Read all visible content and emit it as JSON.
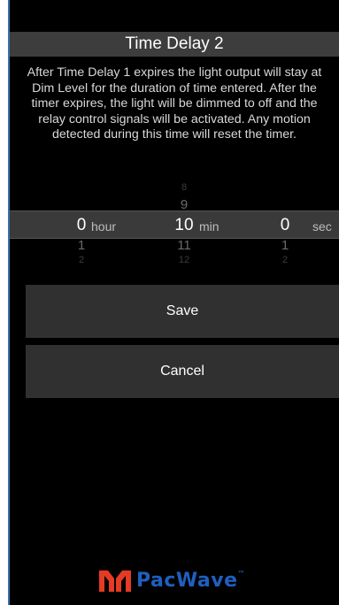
{
  "header": {
    "title": "Time Delay 2"
  },
  "description": "After Time Delay 1 expires the light output will stay at Dim Level for the duration of time entered. After the timer expires, the light will be dimmed to off and the relay control signals will be activated. Any motion detected during this time will reset the timer.",
  "picker": {
    "hours": {
      "prev2": "",
      "prev1": "",
      "selected": "0",
      "next1": "1",
      "next2": "2",
      "unit": "hour"
    },
    "minutes": {
      "prev2": "8",
      "prev1": "9",
      "selected": "10",
      "next1": "11",
      "next2": "12",
      "unit": "min"
    },
    "seconds": {
      "prev2": "",
      "prev1": "",
      "selected": "0",
      "next1": "1",
      "next2": "2",
      "unit": "sec"
    }
  },
  "buttons": {
    "save": "Save",
    "cancel": "Cancel"
  },
  "logo": {
    "text": "PacWave",
    "tm": "™"
  },
  "colors": {
    "brand_blue": "#1f5fbf",
    "brand_red": "#e53a24",
    "background": "#000000"
  }
}
